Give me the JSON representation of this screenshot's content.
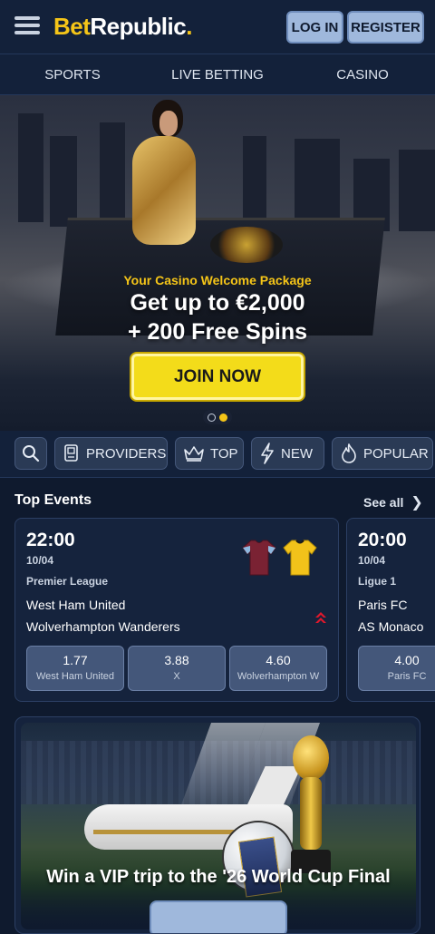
{
  "header": {
    "logo_bet": "Bet",
    "logo_republic": "Republic",
    "logo_dot": ".",
    "login_label": "LOG IN",
    "register_label": "REGISTER"
  },
  "main_nav": [
    {
      "label": "SPORTS"
    },
    {
      "label": "LIVE BETTING"
    },
    {
      "label": "CASINO"
    }
  ],
  "hero": {
    "tagline": "Your Casino Welcome Package",
    "headline_1": "Get up to €2,000",
    "headline_2": "+ 200 Free Spins",
    "cta_label": "JOIN NOW",
    "slides": 2,
    "active_slide": 2
  },
  "filters": [
    {
      "label": "PROVIDERS",
      "icon": "providers-icon"
    },
    {
      "label": "TOP",
      "icon": "crown-icon"
    },
    {
      "label": "NEW",
      "icon": "lightning-icon"
    },
    {
      "label": "POPULAR",
      "icon": "flame-icon"
    }
  ],
  "top_events": {
    "title": "Top Events",
    "see_all_label": "See all",
    "events": [
      {
        "time": "22:00",
        "date": "10/04",
        "league": "Premier League",
        "home": "West Ham United",
        "away": "Wolverhampton Wanderers",
        "home_shirt_color": "#7a2233",
        "away_shirt_color": "#f2c21a",
        "odds": [
          {
            "value": "1.77",
            "label": "West Ham United"
          },
          {
            "value": "3.88",
            "label": "X"
          },
          {
            "value": "4.60",
            "label": "Wolverhampton W"
          }
        ]
      },
      {
        "time": "20:00",
        "date": "10/04",
        "league": "Ligue 1",
        "home": "Paris FC",
        "away": "AS Monaco",
        "odds": [
          {
            "value": "4.00",
            "label": "Paris FC"
          }
        ]
      }
    ]
  },
  "promo": {
    "title": "Win a VIP trip to the '26 World Cup Final"
  },
  "colors": {
    "brand_yellow": "#f5c518",
    "background": "#0f1a2e",
    "button_blue": "#9fb8dc",
    "trend_red": "#e0182c"
  }
}
